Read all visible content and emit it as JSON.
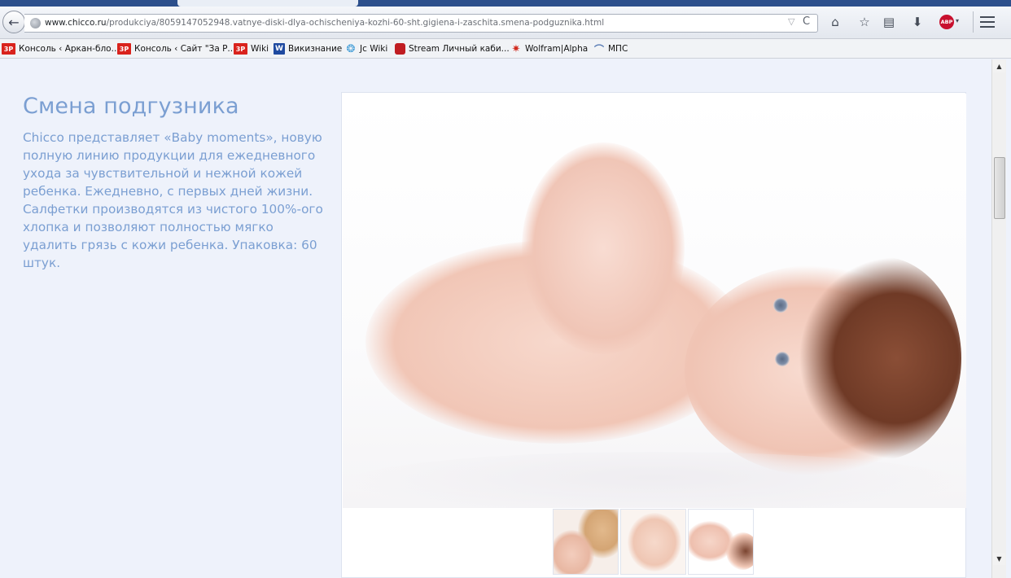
{
  "browser": {
    "back_glyph": "←",
    "url_domain": "www.chicco.ru",
    "url_path": "/produkciya/8059147052948.vatnye-diski-dlya-ochischeniya-kozhi-60-sht.gigiena-i-zaschita.smena-podguznika.html",
    "url_dropdown_glyph": "▽",
    "url_reload_glyph": "C",
    "toolbar_icons": [
      "home-icon",
      "star-icon",
      "reading-list-icon",
      "download-icon",
      "adblock-icon",
      "menu-icon"
    ],
    "home_glyph": "⌂",
    "star_glyph": "☆",
    "reading_list_glyph": "▤",
    "download_glyph": "⬇",
    "abp_label": "ABP",
    "abp_caret": "▾"
  },
  "bookmarks": [
    {
      "icon": "3p",
      "label": "Консоль ‹ Аркан-бло..."
    },
    {
      "icon": "3p",
      "label": "Консоль ‹ Сайт \"За Р..."
    },
    {
      "icon": "3p",
      "label": "Wiki"
    },
    {
      "icon": "W",
      "label": "Викизнание"
    },
    {
      "icon": "jc",
      "label": "Jc Wiki"
    },
    {
      "icon": "stream",
      "label": "Stream Личный каби..."
    },
    {
      "icon": "wolfram",
      "label": "Wolfram|Alpha"
    },
    {
      "icon": "mps",
      "label": "МПС"
    }
  ],
  "bookmark_icon_text": {
    "3p": "3P",
    "W": "W",
    "jc": "❂",
    "stream": "",
    "wolfram": "✷",
    "mps": "⌒"
  },
  "product": {
    "title": "Смена подгузника",
    "description": "Chicco представляет «Baby moments», новую полную линию продукции для ежедневного ухода за чувствительной и нежной кожей ребенка. Ежедневно, с первых дней жизни. Салфетки производятся из чистого 100%-ого хлопка и позволяют полностью мягко удалить грязь с кожи ребенка. Упаковка: 60 штук."
  },
  "gallery": {
    "thumbnail_count": 3
  },
  "scrollbar": {
    "up_glyph": "▲",
    "down_glyph": "▼"
  },
  "colors": {
    "text_accent": "#7b9fd2",
    "page_bg": "#eef2fb",
    "tab_strip": "#2c4f8c"
  }
}
